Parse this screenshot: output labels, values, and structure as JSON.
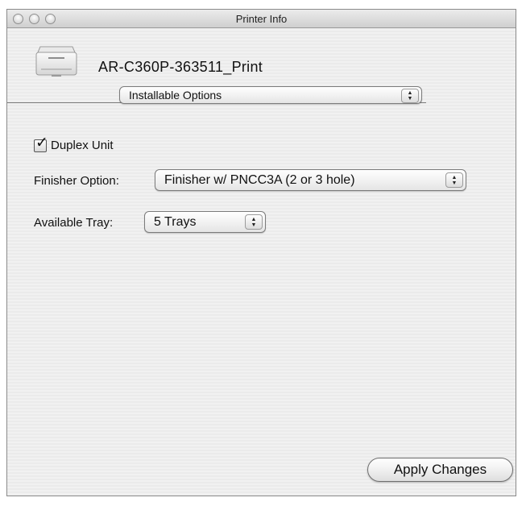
{
  "window": {
    "title": "Printer Info"
  },
  "printer": {
    "name": "AR-C360P-363511_Print",
    "icon": "printer-icon"
  },
  "options_popup": {
    "selected": "Installable Options"
  },
  "duplex": {
    "label": "Duplex Unit",
    "checked": true
  },
  "finisher": {
    "label": "Finisher Option:",
    "selected": "Finisher w/ PNCC3A (2 or 3 hole)"
  },
  "tray": {
    "label": "Available Tray:",
    "selected": "5 Trays"
  },
  "apply_button": {
    "label": "Apply Changes"
  }
}
